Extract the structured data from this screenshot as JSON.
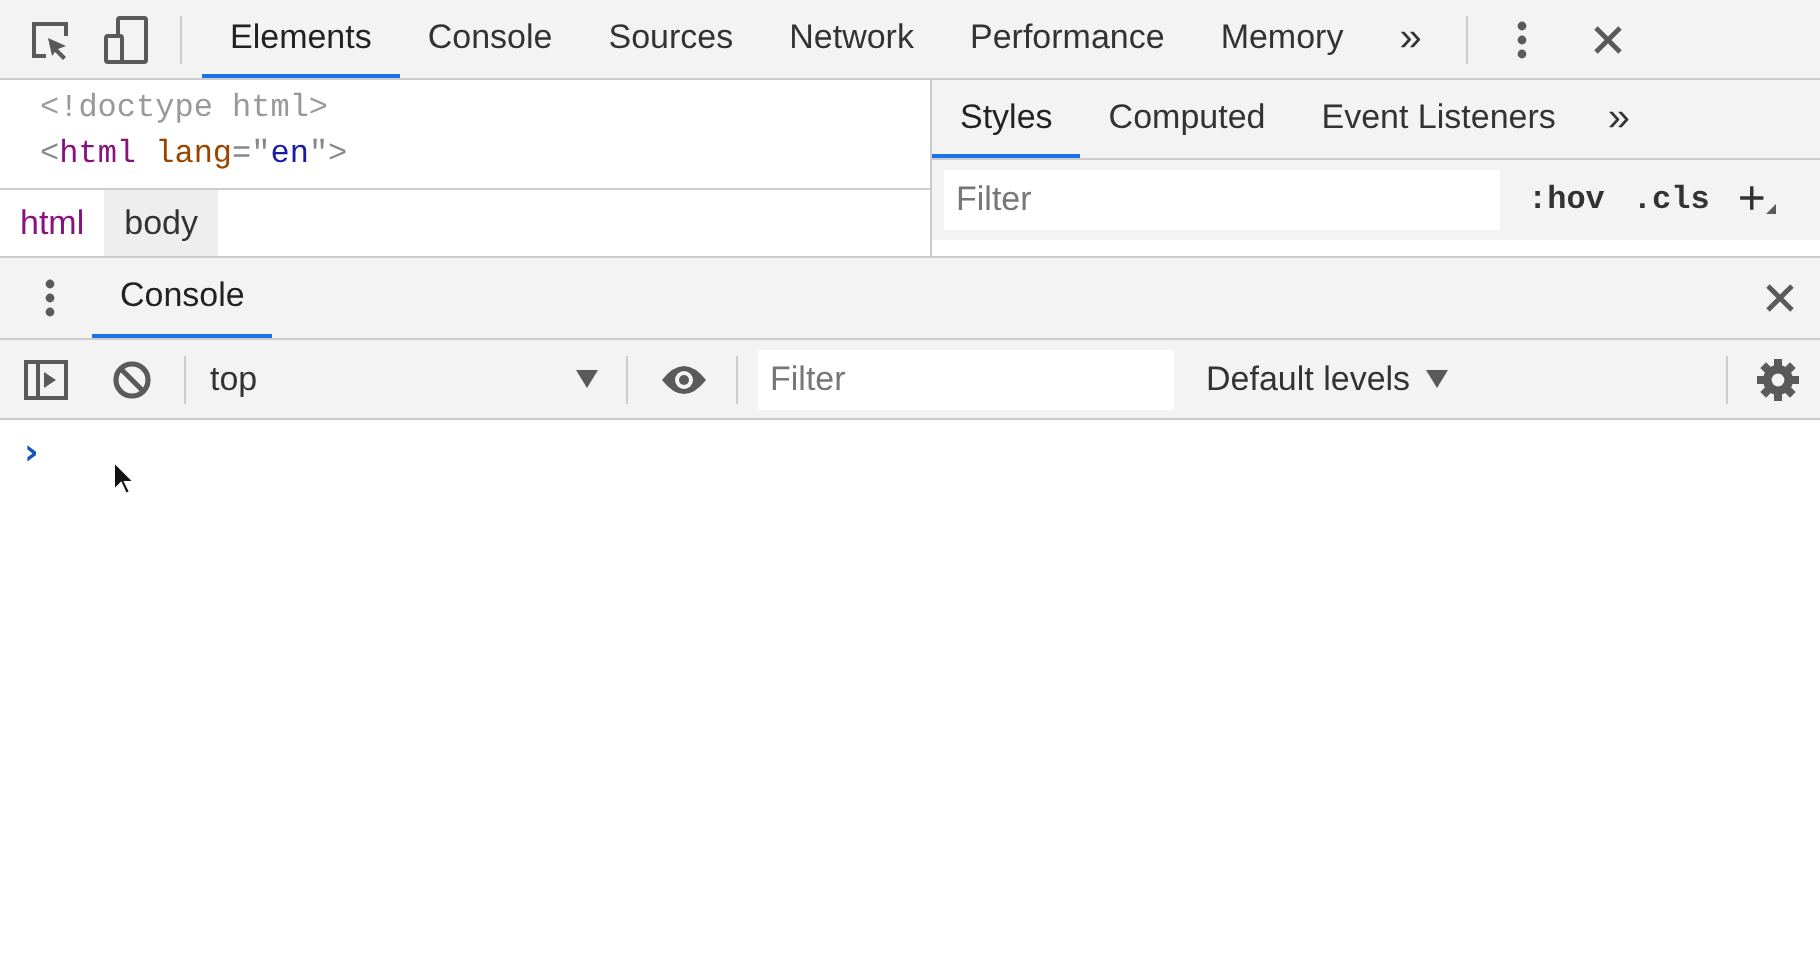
{
  "main_toolbar": {
    "tabs": [
      {
        "label": "Elements",
        "selected": true
      },
      {
        "label": "Console",
        "selected": false
      },
      {
        "label": "Sources",
        "selected": false
      },
      {
        "label": "Network",
        "selected": false
      },
      {
        "label": "Performance",
        "selected": false
      },
      {
        "label": "Memory",
        "selected": false
      }
    ],
    "overflow": "»"
  },
  "dom_tree": {
    "lines": [
      {
        "tokens": [
          {
            "text": "<!doctype html>",
            "kind": "doctype"
          }
        ]
      },
      {
        "tokens": [
          {
            "text": "<",
            "kind": "punct"
          },
          {
            "text": "html",
            "kind": "tag"
          },
          {
            "text": " lang",
            "kind": "attr"
          },
          {
            "text": "=\"",
            "kind": "punct"
          },
          {
            "text": "en",
            "kind": "value"
          },
          {
            "text": "\">",
            "kind": "punct"
          }
        ]
      }
    ]
  },
  "breadcrumbs": [
    {
      "label": "html",
      "selected": false
    },
    {
      "label": "body",
      "selected": true
    }
  ],
  "styles_pane": {
    "tabs": [
      {
        "label": "Styles",
        "selected": true
      },
      {
        "label": "Computed",
        "selected": false
      },
      {
        "label": "Event Listeners",
        "selected": false
      }
    ],
    "overflow": "»",
    "filter": {
      "placeholder": "Filter"
    },
    "hov": ":hov",
    "cls": ".cls",
    "add": "+"
  },
  "drawer": {
    "tabs": [
      {
        "label": "Console",
        "selected": true
      }
    ]
  },
  "console_toolbar": {
    "context": "top",
    "filter": {
      "placeholder": "Filter"
    },
    "levels": "Default levels"
  },
  "console": {
    "prompt": "›"
  }
}
